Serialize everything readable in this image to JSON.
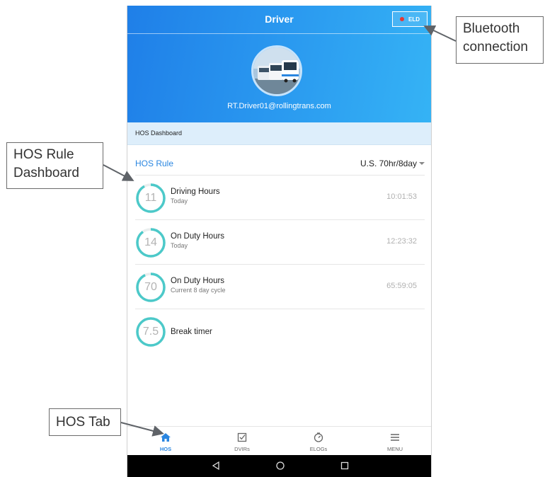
{
  "app_bar": {
    "title": "Driver",
    "eld_label": "ELD",
    "eld_status_color": "#e53935"
  },
  "profile": {
    "email": "RT.Driver01@rollingtrans.com",
    "avatar": "bus-fleet-photo"
  },
  "section": {
    "title": "HOS Dashboard"
  },
  "hos_rule": {
    "label": "HOS Rule",
    "value": "U.S. 70hr/8day"
  },
  "hos_items": [
    {
      "ring_value": "11",
      "title": "Driving Hours",
      "subtitle": "Today",
      "time": "10:01:53",
      "progress": 0.92
    },
    {
      "ring_value": "14",
      "title": "On Duty Hours",
      "subtitle": "Today",
      "time": "12:23:32",
      "progress": 0.9
    },
    {
      "ring_value": "70",
      "title": "On Duty Hours",
      "subtitle": "Current 8 day cycle",
      "time": "65:59:05",
      "progress": 0.93
    },
    {
      "ring_value": "7.5",
      "title": "Break timer",
      "subtitle": "",
      "time": "",
      "progress": 1.0
    }
  ],
  "bottom_nav": [
    {
      "label": "HOS",
      "icon": "home-icon",
      "active": true
    },
    {
      "label": "DVIRs",
      "icon": "checkbox-icon",
      "active": false
    },
    {
      "label": "ELOGs",
      "icon": "timer-icon",
      "active": false
    },
    {
      "label": "MENU",
      "icon": "menu-icon",
      "active": false
    }
  ],
  "callouts": {
    "bluetooth": "Bluetooth connection",
    "hos_rule_dashboard": "HOS Rule Dashboard",
    "hos_tab": "HOS Tab"
  },
  "colors": {
    "header_start": "#1f7fe8",
    "header_end": "#35b3f5",
    "ring": "#4cc9c9",
    "accent": "#2a86e0"
  }
}
